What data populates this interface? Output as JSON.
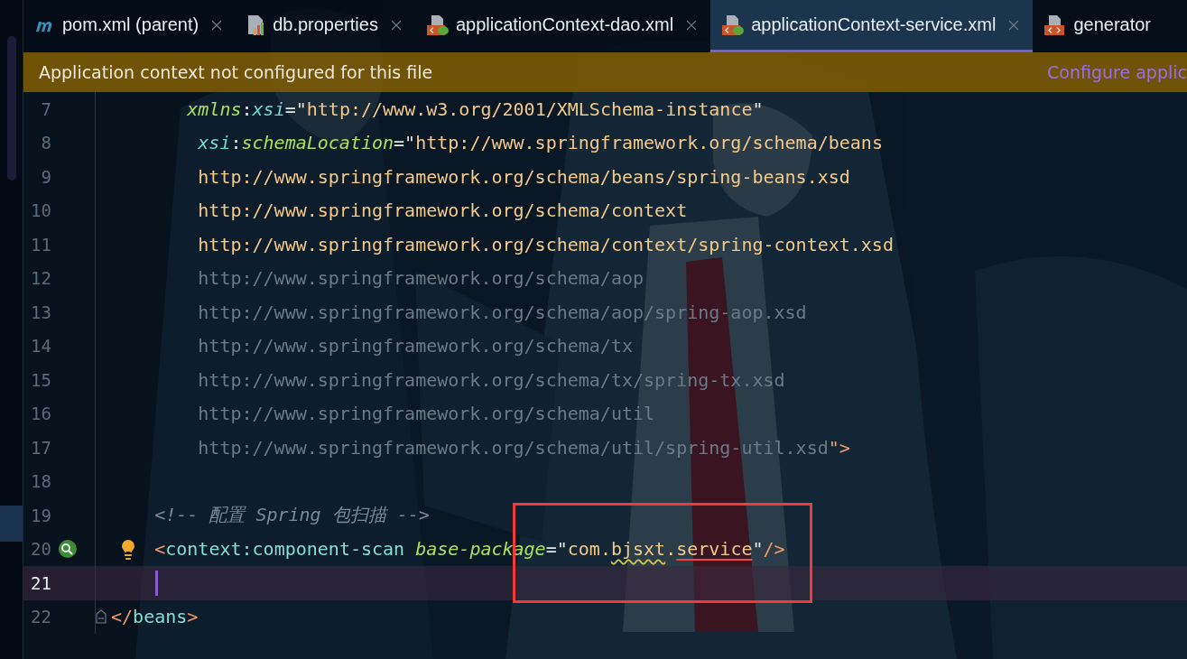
{
  "tabs": [
    {
      "label": "pom.xml (parent)",
      "kind": "maven",
      "selected": false,
      "closable": true
    },
    {
      "label": "db.properties",
      "kind": "properties",
      "selected": false,
      "closable": true
    },
    {
      "label": "applicationContext-dao.xml",
      "kind": "spring-xml",
      "selected": false,
      "closable": true
    },
    {
      "label": "applicationContext-service.xml",
      "kind": "spring-xml",
      "selected": true,
      "closable": true
    },
    {
      "label": "generator",
      "kind": "xml",
      "selected": false,
      "closable": false
    }
  ],
  "banner": {
    "message": "Application context not configured for this file",
    "link": "Configure applic"
  },
  "editor": {
    "lines": [
      {
        "number": "7",
        "kind": "code",
        "current": false,
        "tokens": [
          {
            "text": "       xmlns",
            "kind": "attr"
          },
          {
            "text": ":",
            "kind": "punct"
          },
          {
            "text": "xsi",
            "kind": "ns"
          },
          {
            "text": "=\"",
            "kind": "punct"
          },
          {
            "text": "http://www.w3.org/2001/XMLSchema-instance",
            "kind": "string"
          },
          {
            "text": "\"",
            "kind": "punct"
          }
        ]
      },
      {
        "number": "8",
        "kind": "code",
        "current": false,
        "tokens": [
          {
            "text": "        xsi",
            "kind": "ns"
          },
          {
            "text": ":",
            "kind": "punct"
          },
          {
            "text": "schemaLocation",
            "kind": "attr"
          },
          {
            "text": "=\"",
            "kind": "punct"
          },
          {
            "text": "http://www.springframework.org/schema/beans",
            "kind": "string"
          }
        ]
      },
      {
        "number": "9",
        "kind": "code",
        "current": false,
        "tokens": [
          {
            "text": "        http://www.springframework.org/schema/beans/spring-beans.xsd",
            "kind": "string"
          }
        ]
      },
      {
        "number": "10",
        "kind": "code",
        "current": false,
        "tokens": [
          {
            "text": "        http://www.springframework.org/schema/context",
            "kind": "string"
          }
        ]
      },
      {
        "number": "11",
        "kind": "code",
        "current": false,
        "tokens": [
          {
            "text": "        http://www.springframework.org/schema/context/spring-context.xsd",
            "kind": "string"
          }
        ]
      },
      {
        "number": "12",
        "kind": "code",
        "current": false,
        "tokens": [
          {
            "text": "        http://www.springframework.org/schema/aop",
            "kind": "unused"
          }
        ]
      },
      {
        "number": "13",
        "kind": "code",
        "current": false,
        "tokens": [
          {
            "text": "        http://www.springframework.org/schema/aop/spring-aop.xsd",
            "kind": "unused"
          }
        ]
      },
      {
        "number": "14",
        "kind": "code",
        "current": false,
        "tokens": [
          {
            "text": "        http://www.springframework.org/schema/tx",
            "kind": "unused"
          }
        ]
      },
      {
        "number": "15",
        "kind": "code",
        "current": false,
        "tokens": [
          {
            "text": "        http://www.springframework.org/schema/tx/spring-tx.xsd",
            "kind": "unused"
          }
        ]
      },
      {
        "number": "16",
        "kind": "code",
        "current": false,
        "tokens": [
          {
            "text": "        http://www.springframework.org/schema/util",
            "kind": "unused"
          }
        ]
      },
      {
        "number": "17",
        "kind": "code",
        "current": false,
        "tokens": [
          {
            "text": "        http://www.springframework.org/schema/util/spring-util.xsd",
            "kind": "unused"
          },
          {
            "text": "\">",
            "kind": "bracket"
          }
        ]
      },
      {
        "number": "18",
        "kind": "code",
        "current": false
      },
      {
        "number": "19",
        "kind": "code",
        "current": false,
        "tokens": [
          {
            "text": "    <!-- 配置 Spring 包扫描 -->",
            "kind": "comment"
          }
        ]
      },
      {
        "number": "20",
        "kind": "bean-hint",
        "current": false,
        "tokens": [
          {
            "text": "    <",
            "kind": "bracket"
          },
          {
            "text": "context:component-scan ",
            "kind": "tag"
          },
          {
            "text": "base-package",
            "kind": "attr"
          },
          {
            "text": "=\"",
            "kind": "punct"
          },
          {
            "text": "com.",
            "kind": "string"
          },
          {
            "text": "bjsxt",
            "kind": "typo"
          },
          {
            "text": ".",
            "kind": "string"
          },
          {
            "text": "service",
            "kind": "error"
          },
          {
            "text": "\"",
            "kind": "punct"
          },
          {
            "text": "/>",
            "kind": "bracket"
          }
        ]
      },
      {
        "number": "21",
        "kind": "code",
        "current": true
      },
      {
        "number": "22",
        "kind": "fold-end",
        "current": false,
        "tokens": [
          {
            "text": "</",
            "kind": "bracket"
          },
          {
            "text": "beans",
            "kind": "tag"
          },
          {
            "text": ">",
            "kind": "bracket"
          }
        ]
      }
    ]
  }
}
